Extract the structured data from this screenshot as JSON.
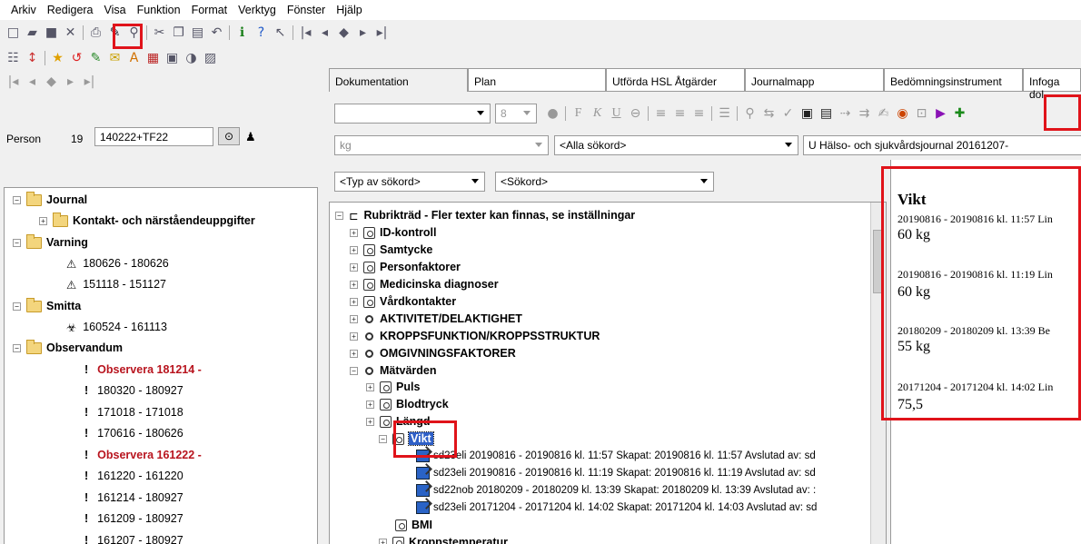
{
  "menu": [
    "Arkiv",
    "Redigera",
    "Visa",
    "Funktion",
    "Format",
    "Verktyg",
    "Fönster",
    "Hjälp"
  ],
  "left": {
    "person_label": "Person",
    "person_nr": "19",
    "person_id": "140222+TF22",
    "tree": {
      "root": "Journal",
      "contact": "Kontakt- och närståendeuppgifter",
      "warning": "Varning",
      "warn1": "180626 - 180626",
      "warn2": "151118 - 151127",
      "infection": "Smitta",
      "inf1": "160524 - 161113",
      "observandum": "Observandum",
      "obs": [
        "Observera 181214 -",
        "180320 - 180927",
        "171018 - 171018",
        "170616 - 180626",
        "Observera 161222 -",
        "161220 - 161220",
        "161214 - 180927",
        "161209 - 180927",
        "161207 - 180927"
      ]
    }
  },
  "tabs": [
    "Dokumentation",
    "Plan",
    "Utförda HSL Åtgärder",
    "Journalmapp",
    "Bedömningsinstrument",
    "Infoga dol"
  ],
  "format": {
    "size": "8"
  },
  "filters": {
    "search_text": "kg",
    "keyword_all": "<Alla sökord>",
    "journal": "U Hälso- och sjukvårdsjournal 20161207-",
    "type": "<Typ av sökord>",
    "keyword": "<Sökord>"
  },
  "main_tree": {
    "root": "Rubrikträd - Fler texter kan finnas, se inställningar",
    "items": [
      "ID-kontroll",
      "Samtycke",
      "Personfaktorer",
      "Medicinska diagnoser",
      "Vårdkontakter",
      "AKTIVITET/DELAKTIGHET",
      "KROPPSFUNKTION/KROPPSSTRUKTUR",
      "OMGIVNINGSFAKTORER",
      "Mätvärden",
      "Puls",
      "Blodtryck",
      "Längd",
      "Vikt"
    ],
    "entries": [
      "sd23eli 20190816 - 20190816  kl. 11:57  Skapat: 20190816 kl. 11:57  Avslutad av: sd",
      "sd23eli 20190816 - 20190816  kl. 11:19  Skapat: 20190816 kl. 11:19  Avslutad av: sd",
      "sd22nob 20180209 - 20180209  kl. 13:39  Skapat: 20180209 kl. 13:39  Avslutad av: :",
      "sd23eli 20171204 - 20171204  kl. 14:02  Skapat: 20171204 kl. 14:03  Avslutad av: sd"
    ],
    "after": [
      "BMI",
      "Kroppstemperatur"
    ]
  },
  "right_panel": {
    "title": "Vikt",
    "entries": [
      {
        "header": "20190816 - 20190816 kl. 11:57  Lin",
        "value": "60 kg"
      },
      {
        "header": "20190816 - 20190816 kl. 11:19  Lin",
        "value": "60 kg"
      },
      {
        "header": "20180209 - 20180209 kl. 13:39  Be",
        "value": "55 kg"
      },
      {
        "header": "20171204 - 20171204 kl. 14:02  Lin",
        "value": "75,5"
      }
    ]
  }
}
